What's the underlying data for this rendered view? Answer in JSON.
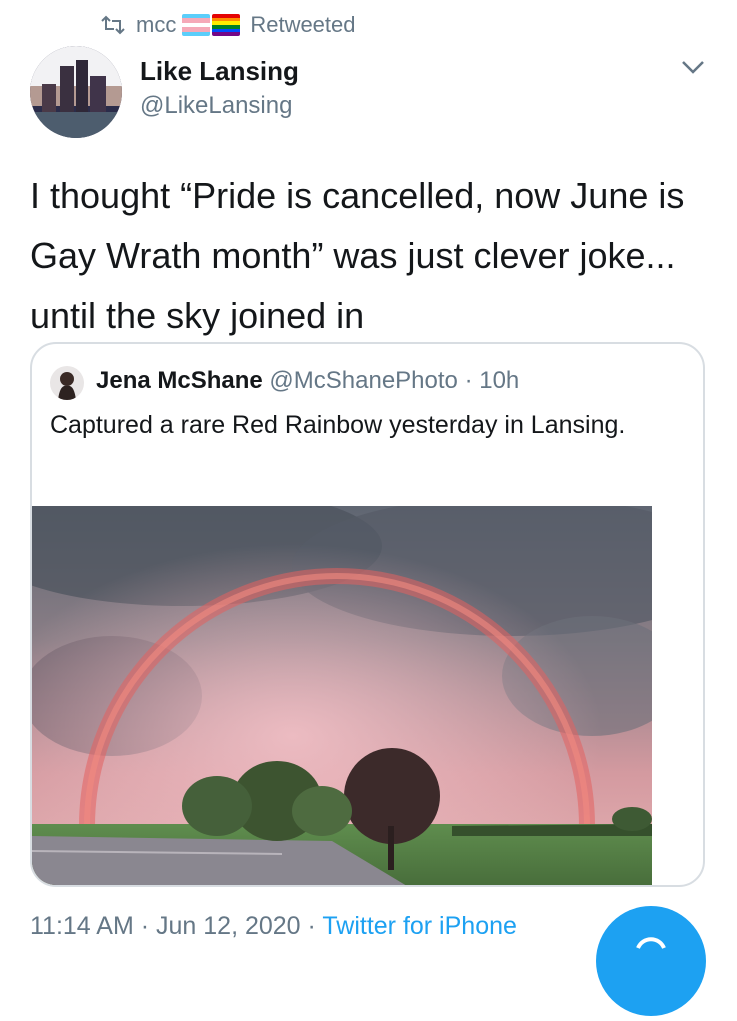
{
  "retweet": {
    "name": "mcc",
    "label": "Retweeted",
    "flags": [
      "trans-pride-flag-emoji",
      "rainbow-pride-flag-emoji"
    ]
  },
  "tweet": {
    "name": "Like Lansing",
    "handle": "@LikeLansing",
    "text": "I thought “Pride is cancelled, now June is Gay Wrath month” was just clever joke... until the sky joined in",
    "time": "11:14 AM",
    "date": "Jun 12, 2020",
    "source": "Twitter for iPhone",
    "separator": "·"
  },
  "quote": {
    "name": "Jena McShane",
    "handle": "@McShanePhoto",
    "separator": "·",
    "time": "10h",
    "text": "Captured a rare Red Rainbow yesterday in Lansing."
  },
  "colors": {
    "accent": "#1da1f2",
    "secondary_text": "#657786",
    "border": "#d8dde2"
  },
  "icons": {
    "retweet": "retweet-icon",
    "menu": "chevron-down-icon",
    "compose": "compose-fab"
  }
}
